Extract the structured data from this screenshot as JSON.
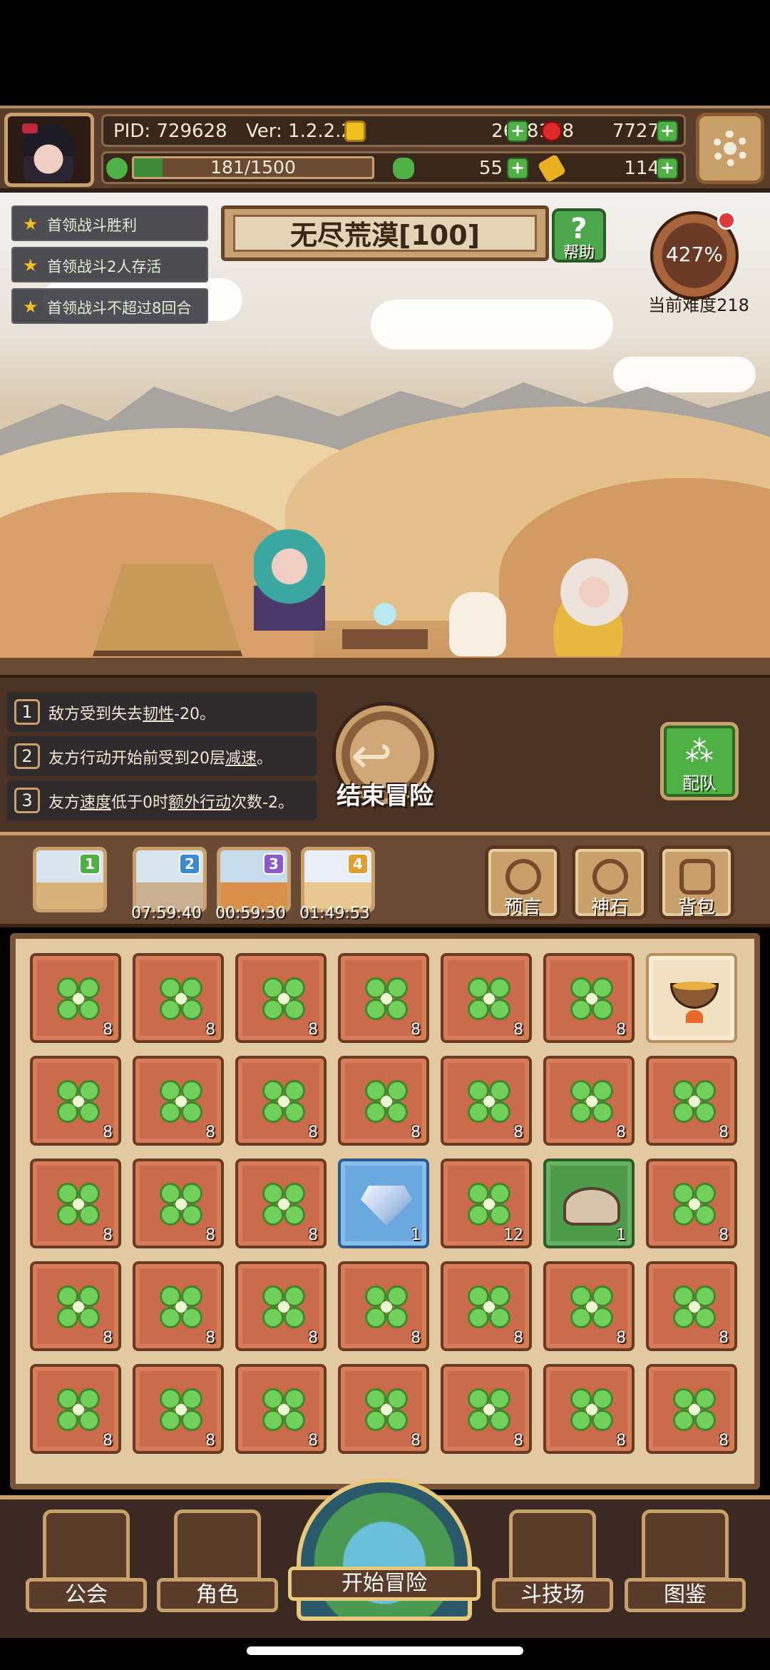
{
  "header": {
    "pid": "PID: 729628",
    "version": "Ver: 1.2.2.2",
    "gold": "2638168",
    "gems": "7727",
    "exp": "181/1500",
    "exp_fraction": 0.12,
    "clovers": "55",
    "keys": "114"
  },
  "quests": [
    "首领战斗胜利",
    "首领战斗2人存活",
    "首领战斗不超过8回合"
  ],
  "stage": {
    "title": "无尽荒漠[100]",
    "help_label": "帮助",
    "difficulty_pct": "427%",
    "difficulty_label": "当前难度218"
  },
  "buffs": [
    {
      "num": "1",
      "pre": "敌方受到失去",
      "u1": "韧性",
      "mid": "-20。",
      "u2": "",
      "post": ""
    },
    {
      "num": "2",
      "pre": "友方行动开始前受到20层",
      "u1": "减速",
      "mid": "。",
      "u2": "",
      "post": ""
    },
    {
      "num": "3",
      "pre": "友方",
      "u1": "速度",
      "mid": "低于0时",
      "u2": "额外行动",
      "post": "次数-2。"
    }
  ],
  "actions": {
    "end_adventure": "结束冒险",
    "team": "配队"
  },
  "regions": [
    {
      "badge": "1",
      "timer": "",
      "badge_color": "#4fb044"
    },
    {
      "badge": "2",
      "timer": "07:59:40",
      "badge_color": "#3a8ad8"
    },
    {
      "badge": "3",
      "timer": "00:59:30",
      "badge_color": "#8a5ad0"
    },
    {
      "badge": "4",
      "timer": "01:49:53",
      "badge_color": "#e0a030"
    }
  ],
  "tools": [
    "预言",
    "神石",
    "背包"
  ],
  "inventory": [
    [
      "8",
      "8",
      "8",
      "8",
      "8",
      "8",
      ""
    ],
    [
      "8",
      "8",
      "8",
      "8",
      "8",
      "8",
      "8"
    ],
    [
      "8",
      "8",
      "8",
      "1",
      "12",
      "1",
      "8"
    ],
    [
      "8",
      "8",
      "8",
      "8",
      "8",
      "8",
      "8"
    ],
    [
      "8",
      "8",
      "8",
      "8",
      "8",
      "8",
      "8"
    ]
  ],
  "inventory_items": [
    [
      "clover",
      "clover",
      "clover",
      "clover",
      "clover",
      "clover",
      "soup-pot"
    ],
    [
      "clover",
      "clover",
      "clover",
      "clover",
      "clover",
      "clover",
      "clover"
    ],
    [
      "clover",
      "clover",
      "clover",
      "diamond",
      "clover",
      "rock",
      "clover"
    ],
    [
      "clover",
      "clover",
      "clover",
      "clover",
      "clover",
      "clover",
      "clover"
    ],
    [
      "clover",
      "clover",
      "clover",
      "clover",
      "clover",
      "clover",
      "clover"
    ]
  ],
  "nav": {
    "guild": "公会",
    "character": "角色",
    "adventure": "开始冒险",
    "arena": "斗技场",
    "codex": "图鉴"
  }
}
